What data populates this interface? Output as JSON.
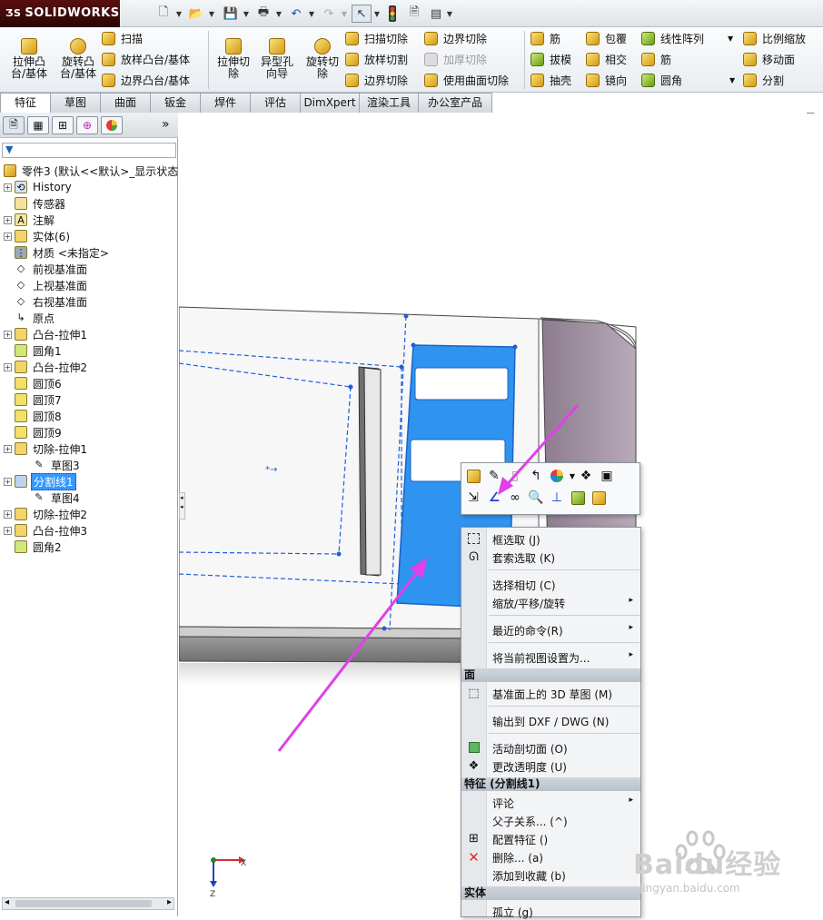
{
  "app": {
    "logo": "SOLIDWORKS"
  },
  "ribbon": {
    "extrude_boss": "拉伸凸台/基体",
    "revolve_boss": "旋转凸台/基体",
    "sweep": "扫描",
    "loft_boss": "放样凸台/基体",
    "boundary_boss": "边界凸台/基体",
    "extrude_cut": "拉伸切除",
    "hole_wizard": "异型孔向导",
    "revolve_cut": "旋转切除",
    "sweep_cut": "扫描切除",
    "loft_cut": "放样切割",
    "boundary_cut": "边界切除",
    "boundary_cut2": "边界切除",
    "thicken_cut": "加厚切除",
    "surface_cut": "使用曲面切除",
    "rib": "筋",
    "draft": "拔模",
    "shell": "抽壳",
    "wrap": "包覆",
    "intersect": "相交",
    "mirror": "镜向",
    "linear_pattern": "线性阵列",
    "rib2": "筋",
    "fillet": "圆角",
    "scale": "比例缩放",
    "move_face": "移动面",
    "split": "分割"
  },
  "tabs": [
    "特征",
    "草图",
    "曲面",
    "钣金",
    "焊件",
    "评估",
    "DimXpert",
    "渲染工具",
    "办公室产品"
  ],
  "tree": {
    "root": "零件3 (默认<<默认>_显示状态",
    "items": [
      {
        "label": "History",
        "icon": "history-icon",
        "exp": true,
        "indent": 0
      },
      {
        "label": "传感器",
        "icon": "sensor-icon",
        "exp": false,
        "indent": 0
      },
      {
        "label": "注解",
        "icon": "annotation-icon",
        "exp": true,
        "indent": 0
      },
      {
        "label": "实体(6)",
        "icon": "solid-bodies-icon",
        "exp": true,
        "indent": 0
      },
      {
        "label": "材质 <未指定>",
        "icon": "material-icon",
        "exp": false,
        "indent": 0
      },
      {
        "label": "前视基准面",
        "icon": "plane-icon",
        "exp": false,
        "indent": 0
      },
      {
        "label": "上视基准面",
        "icon": "plane-icon",
        "exp": false,
        "indent": 0
      },
      {
        "label": "右视基准面",
        "icon": "plane-icon",
        "exp": false,
        "indent": 0
      },
      {
        "label": "原点",
        "icon": "origin-icon",
        "exp": false,
        "indent": 0
      },
      {
        "label": "凸台-拉伸1",
        "icon": "extrude-icon",
        "exp": true,
        "indent": 0
      },
      {
        "label": "圆角1",
        "icon": "fillet-icon",
        "exp": false,
        "indent": 0
      },
      {
        "label": "凸台-拉伸2",
        "icon": "extrude-icon",
        "exp": true,
        "indent": 0
      },
      {
        "label": "圆顶6",
        "icon": "dome-icon",
        "exp": false,
        "indent": 0
      },
      {
        "label": "圆顶7",
        "icon": "dome-icon",
        "exp": false,
        "indent": 0
      },
      {
        "label": "圆顶8",
        "icon": "dome-icon",
        "exp": false,
        "indent": 0
      },
      {
        "label": "圆顶9",
        "icon": "dome-icon",
        "exp": false,
        "indent": 0
      },
      {
        "label": "切除-拉伸1",
        "icon": "cut-extrude-icon",
        "exp": true,
        "indent": 0
      },
      {
        "label": "草图3",
        "icon": "sketch-icon",
        "exp": false,
        "indent": 1
      },
      {
        "label": "分割线1",
        "icon": "split-line-icon",
        "exp": true,
        "indent": 0,
        "selected": true
      },
      {
        "label": "草图4",
        "icon": "sketch-icon",
        "exp": false,
        "indent": 1
      },
      {
        "label": "切除-拉伸2",
        "icon": "cut-extrude-icon",
        "exp": true,
        "indent": 0
      },
      {
        "label": "凸台-拉伸3",
        "icon": "extrude-icon",
        "exp": true,
        "indent": 0
      },
      {
        "label": "圆角2",
        "icon": "fillet-icon",
        "exp": false,
        "indent": 0
      }
    ]
  },
  "menu": {
    "box_select": "框选取 (J)",
    "lasso_select": "套索选取 (K)",
    "select_tangency": "选择相切 (C)",
    "zoom_pan_rotate": "缩放/平移/旋转",
    "recent_commands": "最近的命令(R)",
    "set_view": "将当前视图设置为...",
    "face_header": "面",
    "sketch3d": "基准面上的 3D 草图 (M)",
    "export_dxf": "输出到 DXF / DWG (N)",
    "live_section": "活动剖切面 (O)",
    "change_transparency": "更改透明度 (U)",
    "feature_header": "特征 (分割线1)",
    "comment": "评论",
    "parent_child": "父子关系... (^)",
    "configure_feature": "配置特征 ()",
    "delete": "删除... (a)",
    "add_favorite": "添加到收藏 (b)",
    "body_header": "实体",
    "isolate": "孤立 (g)"
  },
  "triad": {
    "x": "X",
    "z": "Z"
  },
  "watermark": {
    "text": "Baidu经验",
    "sub": "jingyan.baidu.com"
  },
  "colors": {
    "selection_blue": "#2f93f0",
    "arrow_magenta": "#e040e8",
    "menu_bg": "#f3f4f6"
  }
}
